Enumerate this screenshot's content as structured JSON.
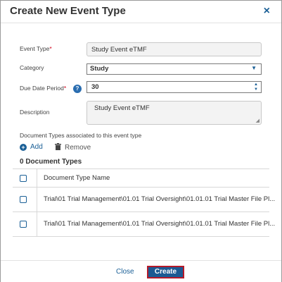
{
  "dialog": {
    "title": "Create New Event Type",
    "close_icon": "×"
  },
  "form": {
    "event_type": {
      "label": "Event Type",
      "required": "*",
      "value": "Study Event eTMF"
    },
    "category": {
      "label": "Category",
      "value": "Study"
    },
    "due_date_period": {
      "label": "Due Date Period",
      "required": "*",
      "value": "30",
      "help_icon": "?"
    },
    "description": {
      "label": "Description",
      "value": "Study Event eTMF"
    }
  },
  "document_types": {
    "section_label": "Document Types associated to this event type",
    "add_label": "Add",
    "remove_label": "Remove",
    "count_label": "0 Document Types",
    "column_header": "Document Type Name",
    "rows": [
      "Trial\\01 Trial Management\\01.01 Trial Oversight\\01.01.01 Trial Master File Pl...",
      "Trial\\01 Trial Management\\01.01 Trial Oversight\\01.01.01 Trial Master File Pl..."
    ]
  },
  "footer": {
    "close_label": "Close",
    "create_label": "Create"
  },
  "colors": {
    "accent": "#1a5f96",
    "create_button": "#1c5a93",
    "create_border": "#b51a2a",
    "required": "#d0021b"
  }
}
